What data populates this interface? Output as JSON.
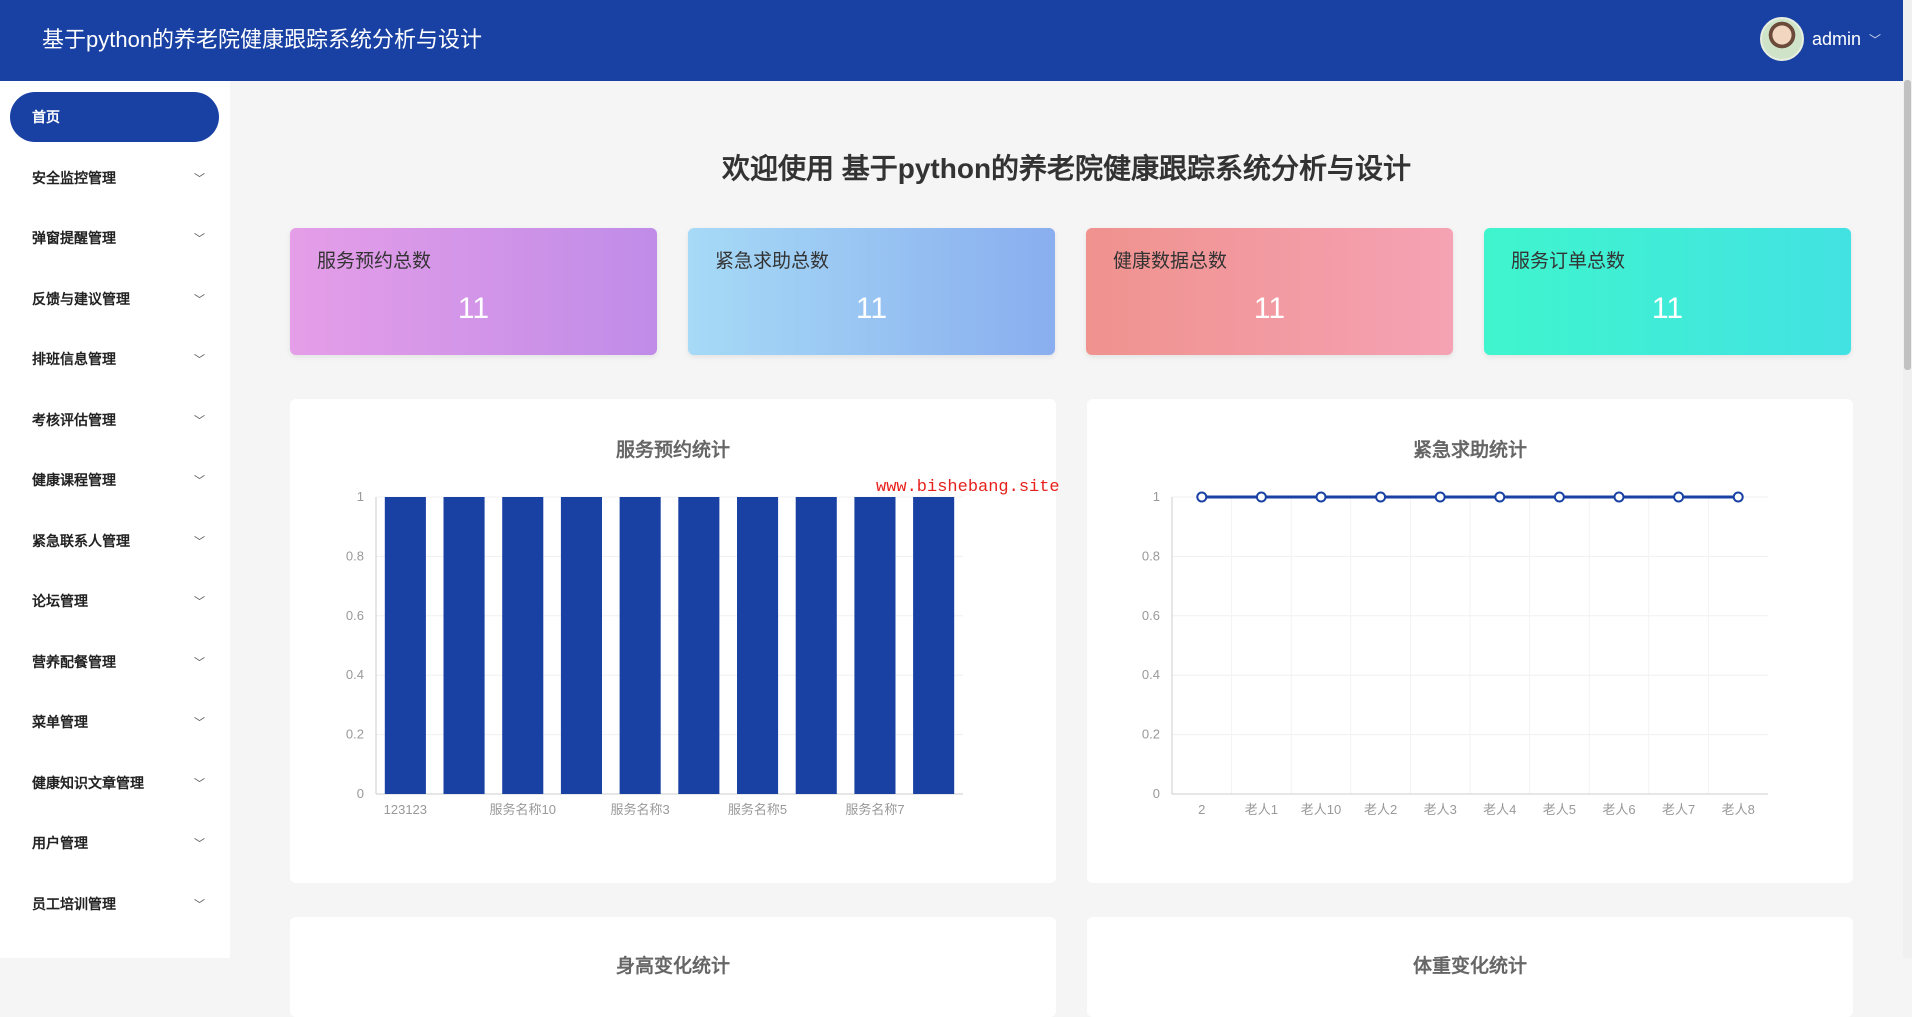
{
  "header": {
    "title": "基于python的养老院健康跟踪系统分析与设计",
    "user": "admin"
  },
  "sidebar": {
    "items": [
      {
        "label": "首页",
        "active": true
      },
      {
        "label": "安全监控管理"
      },
      {
        "label": "弹窗提醒管理"
      },
      {
        "label": "反馈与建议管理"
      },
      {
        "label": "排班信息管理"
      },
      {
        "label": "考核评估管理"
      },
      {
        "label": "健康课程管理"
      },
      {
        "label": "紧急联系人管理"
      },
      {
        "label": "论坛管理"
      },
      {
        "label": "营养配餐管理"
      },
      {
        "label": "菜单管理"
      },
      {
        "label": "健康知识文章管理"
      },
      {
        "label": "用户管理"
      },
      {
        "label": "员工培训管理"
      }
    ]
  },
  "main": {
    "welcome": "欢迎使用 基于python的养老院健康跟踪系统分析与设计",
    "stats": [
      {
        "label": "服务预约总数",
        "value": "11",
        "from": "#e59ee8",
        "to": "#c08ce8"
      },
      {
        "label": "紧急求助总数",
        "value": "11",
        "from": "#a6daf6",
        "to": "#8aaeef"
      },
      {
        "label": "健康数据总数",
        "value": "11",
        "from": "#f0928e",
        "to": "#f5a2b4"
      },
      {
        "label": "服务订单总数",
        "value": "11",
        "from": "#3ff5cd",
        "to": "#42e2e2"
      }
    ],
    "bottom_titles": [
      "身高变化统计",
      "体重变化统计"
    ]
  },
  "watermark": "www.bishebang.site",
  "chart_data": [
    {
      "type": "bar",
      "title": "服务预约统计",
      "categories": [
        "123123",
        "",
        "服务名称10",
        "",
        "服务名称3",
        "",
        "服务名称5",
        "",
        "服务名称7",
        ""
      ],
      "values": [
        1,
        1,
        1,
        1,
        1,
        1,
        1,
        1,
        1,
        1
      ],
      "ylim": [
        0,
        1
      ],
      "yticks": [
        "0",
        "0.2",
        "0.4",
        "0.6",
        "0.8",
        "1"
      ],
      "color": "#1841a3"
    },
    {
      "type": "line",
      "title": "紧急求助统计",
      "categories": [
        "2",
        "老人1",
        "老人10",
        "老人2",
        "老人3",
        "老人4",
        "老人5",
        "老人6",
        "老人7",
        "老人8"
      ],
      "values": [
        1,
        1,
        1,
        1,
        1,
        1,
        1,
        1,
        1,
        1
      ],
      "ylim": [
        0,
        1
      ],
      "yticks": [
        "0",
        "0.2",
        "0.4",
        "0.6",
        "0.8",
        "1"
      ],
      "color": "#1841a3"
    }
  ]
}
